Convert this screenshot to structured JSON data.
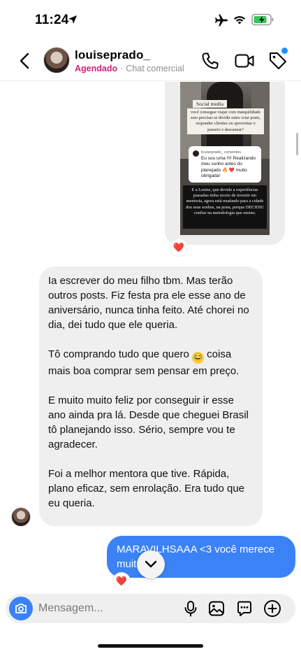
{
  "status_bar": {
    "time": "11:24",
    "icons": [
      "location-arrow-icon",
      "airplane-icon",
      "wifi-icon",
      "battery-charging-icon"
    ],
    "battery_color": "#34c759"
  },
  "header": {
    "contact_name": "louiseprado_",
    "status_tag": "Agendado",
    "status_dot": "·",
    "chat_type": "Chat comercial",
    "tag_color": "#d4207a",
    "icons": [
      "back-icon",
      "phone-icon",
      "video-icon",
      "label-tag-icon"
    ]
  },
  "shared_post": {
    "label": "Social media",
    "caption": "você consegue viajar com tranquilidade sem precisar se dividir entre criar posts, responder clientes ou aproveitar o passeio e descansar?",
    "comment_user": "louiseprado_ comentou",
    "comment_text": "Eu sou uma !!!! Realizando meu sonho antes do planejado 🔥 ❤️ muito obrigada!",
    "story_text": "E a Louise, que devido a experiências passadas tinha receio de investir em mentoria, agora está mudando para a cidade dos seus sonhos, na praia, porque DECIDIU confiar na metodologia que ensino.",
    "reaction": "❤️"
  },
  "incoming_message": {
    "paragraphs": [
      "Ia escrever do meu filho tbm. Mas terão outros posts. Fiz festa pra ele esse ano de aniversário, nunca tinha feito. Até chorei no dia, dei tudo que ele queria.",
      "Tô comprando tudo que quero",
      "coisa mais boa comprar sem pensar em preço.",
      "E muito muito feliz por conseguir ir esse ano ainda pra lá. Desde que cheguei Brasil tô planejando isso. Sério, sempre vou te agradecer.",
      "Foi a melhor mentora que tive. Rápida, plano eficaz, sem enrolação. Era tudo que eu queria."
    ],
    "emoji": "😂"
  },
  "outgoing_message": {
    "text": "MARAVILHSAAA <3 você merece muito",
    "reaction": "❤️",
    "bubble_color": "#3b82f6"
  },
  "composer": {
    "placeholder": "Mensagem...",
    "icons": [
      "camera-icon",
      "microphone-icon",
      "gallery-icon",
      "sticker-icon",
      "plus-icon"
    ]
  },
  "scroll_down_icon": "chevron-down-icon"
}
